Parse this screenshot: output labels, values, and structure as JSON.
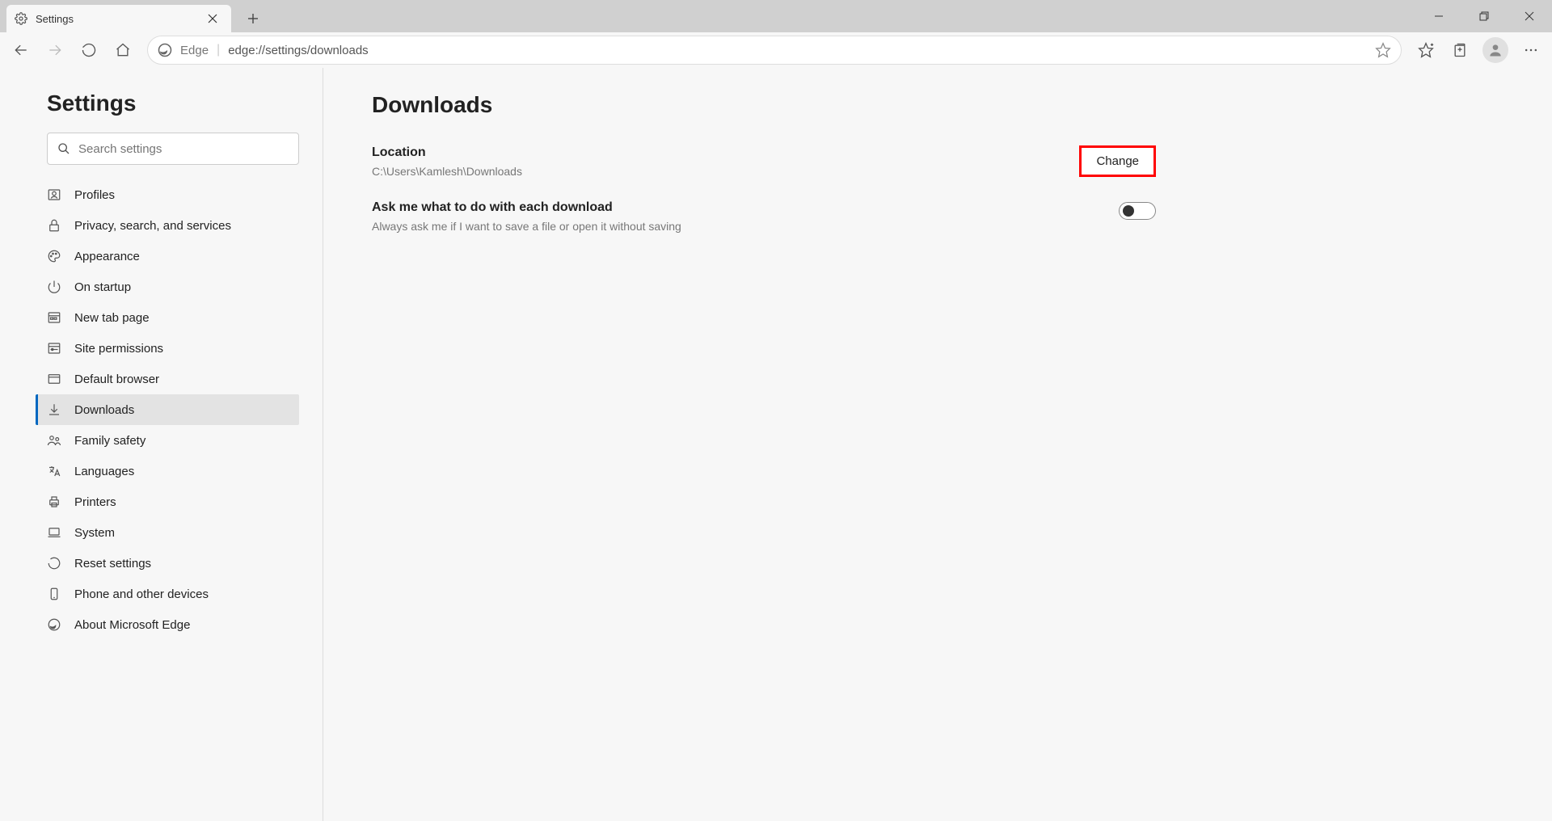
{
  "tab": {
    "title": "Settings"
  },
  "omnibox": {
    "brand": "Edge",
    "url": "edge://settings/downloads"
  },
  "sidebar": {
    "title": "Settings",
    "search_placeholder": "Search settings",
    "items": [
      {
        "label": "Profiles"
      },
      {
        "label": "Privacy, search, and services"
      },
      {
        "label": "Appearance"
      },
      {
        "label": "On startup"
      },
      {
        "label": "New tab page"
      },
      {
        "label": "Site permissions"
      },
      {
        "label": "Default browser"
      },
      {
        "label": "Downloads"
      },
      {
        "label": "Family safety"
      },
      {
        "label": "Languages"
      },
      {
        "label": "Printers"
      },
      {
        "label": "System"
      },
      {
        "label": "Reset settings"
      },
      {
        "label": "Phone and other devices"
      },
      {
        "label": "About Microsoft Edge"
      }
    ]
  },
  "main": {
    "title": "Downloads",
    "location": {
      "label": "Location",
      "path": "C:\\Users\\Kamlesh\\Downloads",
      "change_button": "Change"
    },
    "ask": {
      "label": "Ask me what to do with each download",
      "desc": "Always ask me if I want to save a file or open it without saving",
      "enabled": false
    }
  }
}
